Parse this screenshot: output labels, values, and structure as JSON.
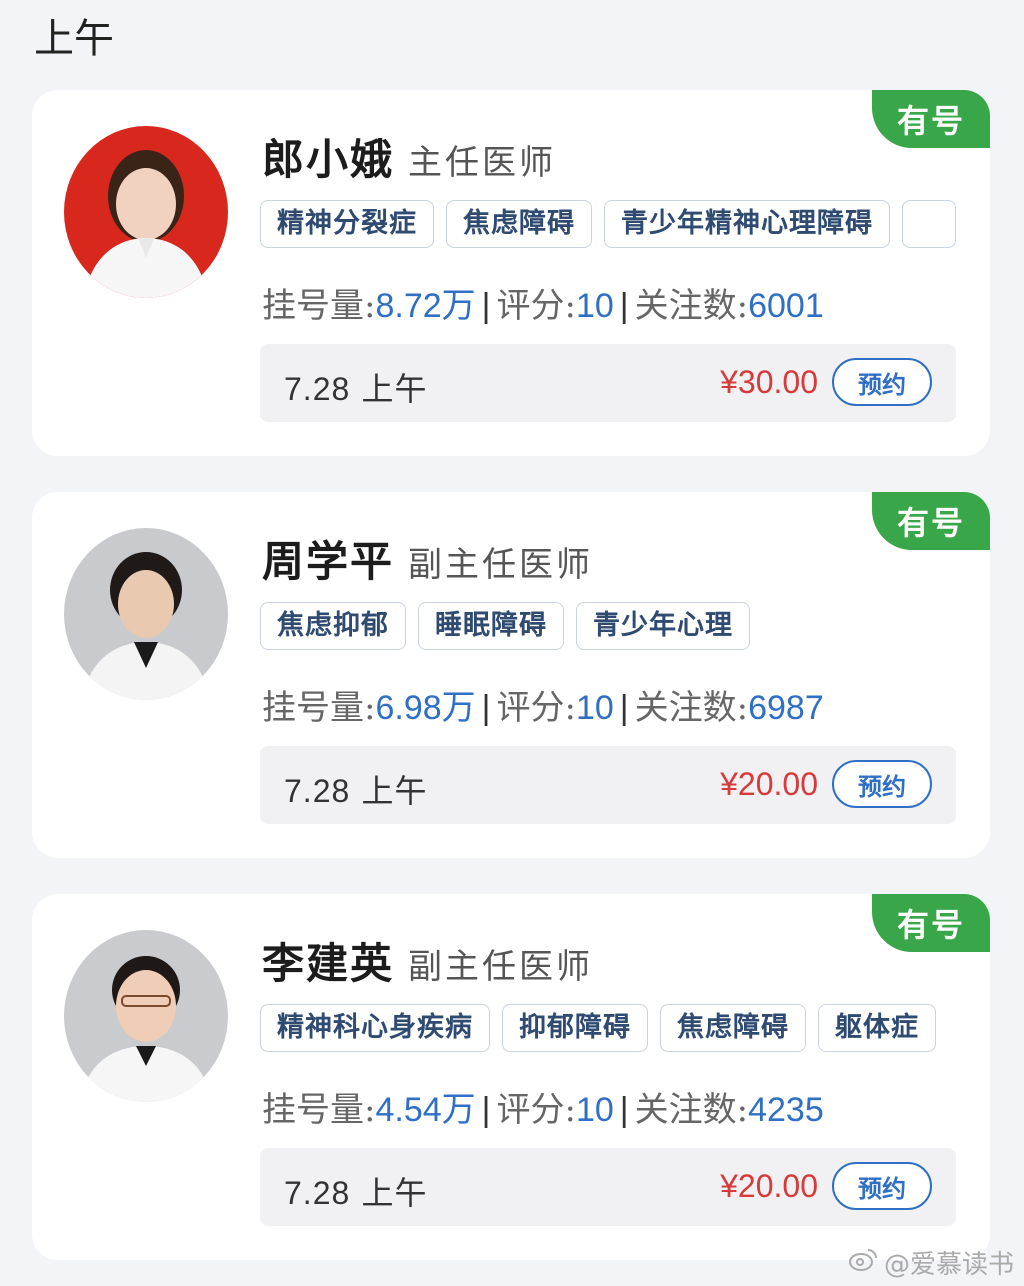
{
  "section": {
    "title": "上午"
  },
  "doctors": [
    {
      "name": "郎小娥",
      "title": "主任医师",
      "availability": "有号",
      "tags": [
        "精神分裂症",
        "焦虑障碍",
        "青少年精神心理障碍",
        ""
      ],
      "stats": {
        "reg_label": "挂号量:",
        "reg_value": "8.72万",
        "sep": "|",
        "score_label": "评分:",
        "score_value": "10",
        "follow_label": "关注数:",
        "follow_value": "6001"
      },
      "slot": {
        "date": "7.28",
        "period": "上午",
        "price": "¥30.00",
        "book_label": "预约"
      }
    },
    {
      "name": "周学平",
      "title": "副主任医师",
      "availability": "有号",
      "tags": [
        "焦虑抑郁",
        "睡眠障碍",
        "青少年心理"
      ],
      "stats": {
        "reg_label": "挂号量:",
        "reg_value": "6.98万",
        "sep": "|",
        "score_label": "评分:",
        "score_value": "10",
        "follow_label": "关注数:",
        "follow_value": "6987"
      },
      "slot": {
        "date": "7.28",
        "period": "上午",
        "price": "¥20.00",
        "book_label": "预约"
      }
    },
    {
      "name": "李建英",
      "title": "副主任医师",
      "availability": "有号",
      "tags": [
        "精神科心身疾病",
        "抑郁障碍",
        "焦虑障碍",
        "躯体症"
      ],
      "stats": {
        "reg_label": "挂号量:",
        "reg_value": "4.54万",
        "sep": "|",
        "score_label": "评分:",
        "score_value": "10",
        "follow_label": "关注数:",
        "follow_value": "4235"
      },
      "slot": {
        "date": "7.28",
        "period": "上午",
        "price": "¥20.00",
        "book_label": "预约"
      }
    }
  ],
  "watermark": {
    "text": "@爱慕读书",
    "icon": "weibo-icon"
  },
  "colors": {
    "available": "#3aa64a",
    "link": "#2f6fc5",
    "price": "#d63a3a",
    "tag_text": "#2f4b72"
  }
}
